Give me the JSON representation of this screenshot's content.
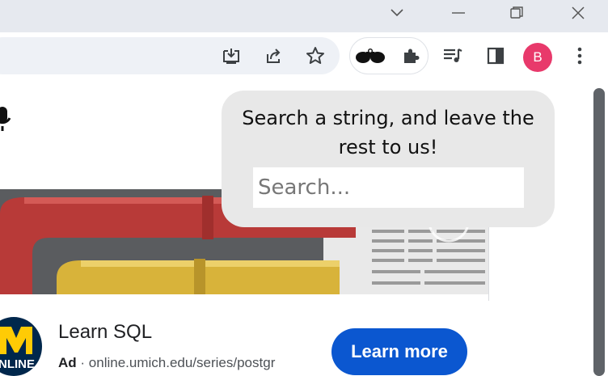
{
  "window": {
    "avatar_letter": "B"
  },
  "toolbar": {
    "icons": [
      "install-app-icon",
      "share-icon",
      "bookmark-star-icon",
      "binoculars-extension-icon",
      "extensions-puzzle-icon",
      "reading-list-icon",
      "side-panel-icon",
      "menu-kebab-icon"
    ]
  },
  "popup": {
    "message": "Search a string, and leave the rest to us!",
    "search_placeholder": "Search...",
    "search_value": ""
  },
  "ad": {
    "title": "Learn SQL",
    "ad_label": "Ad",
    "separator": " · ",
    "url": "online.umich.edu/series/postgr",
    "cta_label": "Learn more",
    "logo_text": "NLINE"
  },
  "colors": {
    "accent": "#0b57d0",
    "avatar": "#e8396b",
    "popup_bg": "#e8e8e8"
  }
}
